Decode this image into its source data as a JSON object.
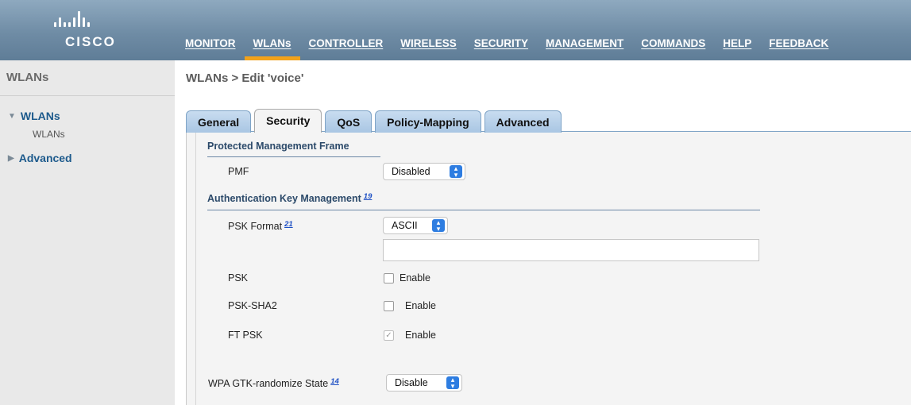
{
  "brand": {
    "logo_text": "CISCO"
  },
  "nav": [
    {
      "label": "MONITOR"
    },
    {
      "label": "WLANs"
    },
    {
      "label": "CONTROLLER"
    },
    {
      "label": "WIRELESS"
    },
    {
      "label": "SECURITY"
    },
    {
      "label": "MANAGEMENT"
    },
    {
      "label": "COMMANDS"
    },
    {
      "label": "HELP"
    },
    {
      "label": "FEEDBACK"
    }
  ],
  "active_nav": "WLANs",
  "sidebar": {
    "title": "WLANs",
    "groups": [
      {
        "label": "WLANs",
        "expanded": true,
        "children": [
          "WLANs"
        ]
      },
      {
        "label": "Advanced",
        "expanded": false
      }
    ]
  },
  "page_title": "WLANs > Edit  'voice'",
  "tabs": [
    {
      "label": "General"
    },
    {
      "label": "Security"
    },
    {
      "label": "QoS"
    },
    {
      "label": "Policy-Mapping"
    },
    {
      "label": "Advanced"
    }
  ],
  "active_tab": "Security",
  "form": {
    "pmf_section": "Protected Management Frame",
    "pmf_label": "PMF",
    "pmf_value": "Disabled",
    "akm_section": "Authentication Key Management",
    "akm_footnote": "19",
    "psk_format_label": "PSK Format",
    "psk_format_footnote": "21",
    "psk_format_value": "ASCII",
    "psk_value": "",
    "psk_label": "PSK",
    "psk_enable": "Enable",
    "psk_checked": false,
    "psk_sha2_label": "PSK-SHA2",
    "psk_sha2_enable": "Enable",
    "psk_sha2_checked": false,
    "ft_psk_label": "FT PSK",
    "ft_psk_enable": "Enable",
    "ft_psk_checked": true,
    "gtk_label": "WPA GTK-randomize State",
    "gtk_footnote": "14",
    "gtk_value": "Disable"
  },
  "colors": {
    "header": "#6f8ca5",
    "active_nav_underline": "#f2a21a",
    "sidebar_bg": "#e9e9e9",
    "section_title": "#2c4a6a",
    "select_chevron": "#2e7de1"
  }
}
